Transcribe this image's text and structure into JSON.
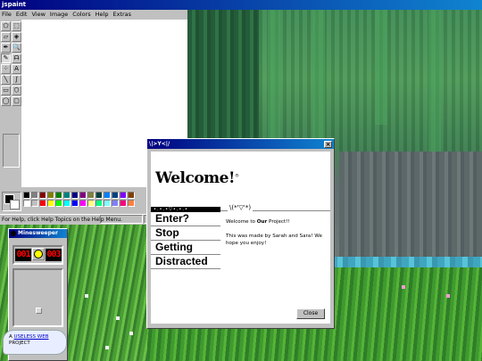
{
  "paint": {
    "title": "jspaint",
    "menus": [
      {
        "label": "File"
      },
      {
        "label": "Edit"
      },
      {
        "label": "View"
      },
      {
        "label": "Image"
      },
      {
        "label": "Colors"
      },
      {
        "label": "Help"
      },
      {
        "label": "Extras"
      }
    ],
    "tools": [
      {
        "name": "free-form-select-icon",
        "glyph": "⬠"
      },
      {
        "name": "select-icon",
        "glyph": "⬚"
      },
      {
        "name": "eraser-icon",
        "glyph": "▱"
      },
      {
        "name": "fill-icon",
        "glyph": "◈"
      },
      {
        "name": "pick-color-icon",
        "glyph": "✒"
      },
      {
        "name": "magnifier-icon",
        "glyph": "🔍"
      },
      {
        "name": "pencil-icon",
        "glyph": "✎"
      },
      {
        "name": "brush-icon",
        "glyph": "ᗩ"
      },
      {
        "name": "airbrush-icon",
        "glyph": "⁘"
      },
      {
        "name": "text-icon",
        "glyph": "A"
      },
      {
        "name": "line-icon",
        "glyph": "╲"
      },
      {
        "name": "curve-icon",
        "glyph": "∫"
      },
      {
        "name": "rectangle-icon",
        "glyph": "▭"
      },
      {
        "name": "polygon-icon",
        "glyph": "⬡"
      },
      {
        "name": "ellipse-icon",
        "glyph": "◯"
      },
      {
        "name": "rounded-rectangle-icon",
        "glyph": "▢"
      }
    ],
    "palette": [
      "#000000",
      "#808080",
      "#800000",
      "#808000",
      "#008000",
      "#008080",
      "#000080",
      "#800080",
      "#808040",
      "#004040",
      "#0080ff",
      "#004080",
      "#8000ff",
      "#804000",
      "#ffffff",
      "#c0c0c0",
      "#ff0000",
      "#ffff00",
      "#00ff00",
      "#00ffff",
      "#0000ff",
      "#ff00ff",
      "#ffff80",
      "#00ff80",
      "#80ffff",
      "#8080ff",
      "#ff0080",
      "#ff8040"
    ],
    "status": "For Help, click Help Topics on the Help Menu."
  },
  "minesweeper": {
    "title": "Minesweeper",
    "mines_left": "001",
    "timer": "003"
  },
  "bubble": {
    "prefix": "A",
    "link": "USELESS WEB",
    "suffix": "PROJECT"
  },
  "dialog": {
    "title": "\\|>Y<|/",
    "heading": "Welcome!",
    "heading_mark": "®",
    "nav_header": "•.•.•▽•.•.•",
    "nav_items": [
      {
        "label": "Enter?"
      },
      {
        "label": "Stop"
      },
      {
        "label": "Getting"
      },
      {
        "label": "Distracted"
      }
    ],
    "kaomoji": "\\(*'▽'*)",
    "welcome_pre": "Welcome to ",
    "welcome_bold": "Our",
    "welcome_post": " Project!!",
    "made_by": "This was made by Sarah and Sara! We hope you enjoy!",
    "close_label": "Close"
  }
}
